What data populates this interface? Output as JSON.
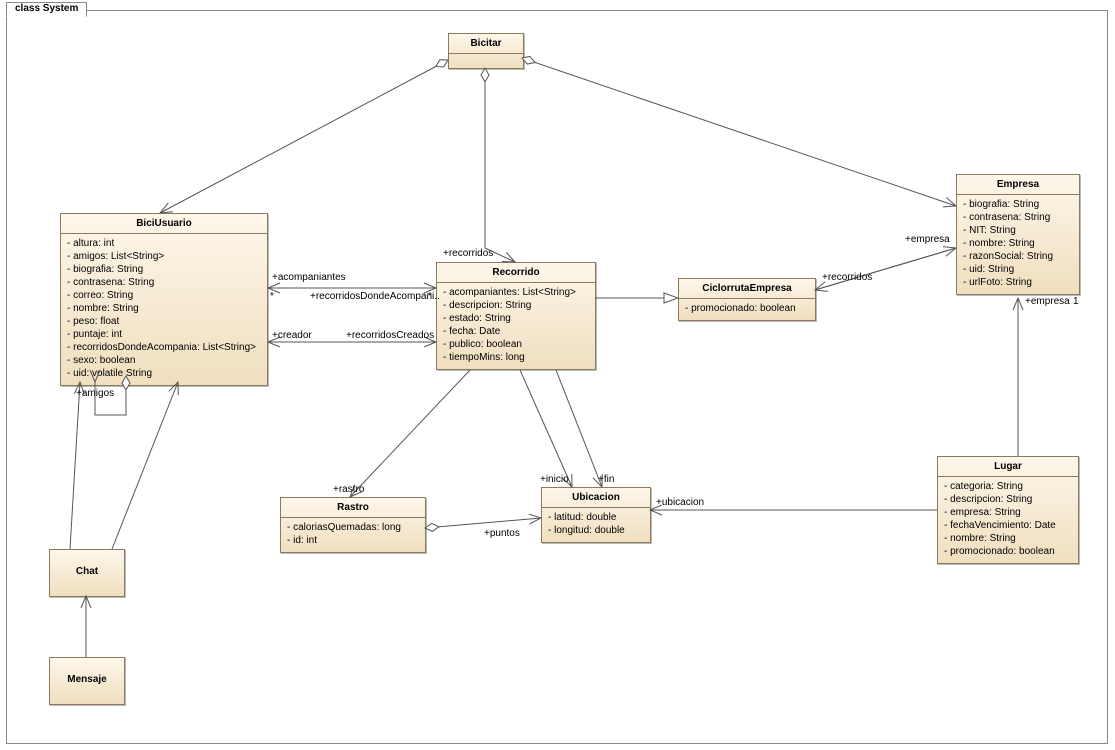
{
  "diagram": {
    "title": "class System"
  },
  "classes": {
    "bicitar": {
      "name": "Bicitar"
    },
    "biciusuario": {
      "name": "BiciUsuario",
      "attrs": [
        "-   altura: int",
        "-   amigos: List<String>",
        "-   biografia: String",
        "-   contrasena: String",
        "-   correo: String",
        "-   nombre: String",
        "-   peso: float",
        "-   puntaje: int",
        "-   recorridosDondeAcompania: List<String>",
        "-   sexo: boolean",
        "-   uid: volatile String"
      ]
    },
    "recorrido": {
      "name": "Recorrido",
      "attrs": [
        "-   acompaniantes: List<String>",
        "-   descripcion: String",
        "-   estado: String",
        "-   fecha: Date",
        "-   publico: boolean",
        "-   tiempoMins: long"
      ]
    },
    "ciclorruta": {
      "name": "CiclorrutaEmpresa",
      "attrs": [
        "-   promocionado: boolean"
      ]
    },
    "empresa": {
      "name": "Empresa",
      "attrs": [
        "-   biografia: String",
        "-   contrasena: String",
        "-   NIT: String",
        "-   nombre: String",
        "-   razonSocial: String",
        "-   uid: String",
        "-   urlFoto: String"
      ]
    },
    "lugar": {
      "name": "Lugar",
      "attrs": [
        "-   categoria: String",
        "-   descripcion: String",
        "-   empresa: String",
        "-   fechaVencimiento: Date",
        "-   nombre: String",
        "-   promocionado: boolean"
      ]
    },
    "ubicacion": {
      "name": "Ubicacion",
      "attrs": [
        "-   latitud: double",
        "-   longitud: double"
      ]
    },
    "rastro": {
      "name": "Rastro",
      "attrs": [
        "-   caloriasQuemadas: long",
        "-   id: int"
      ]
    },
    "chat": {
      "name": "Chat"
    },
    "mensaje": {
      "name": "Mensaje"
    }
  },
  "labels": {
    "recorridos1": "+recorridos",
    "acompaniantes": "+acompaniantes",
    "recorridosDondeAcompani": "+recorridosDondeAcompani..",
    "star1": "*",
    "star2": "*",
    "creador": "+creador",
    "recorridosCreados": "+recorridosCreados",
    "empresa1": "+empresa",
    "recorridos2": "+recorridos",
    "empresa2": "+empresa",
    "one": "1",
    "amigos": "+amigos",
    "rastro": "+rastro",
    "inicio": "+inicio",
    "fin": "+fin",
    "ubicacion": "+ubicacion",
    "puntos": "+puntos"
  }
}
